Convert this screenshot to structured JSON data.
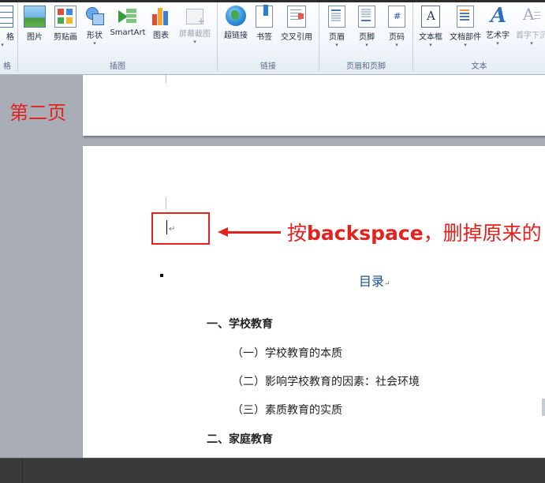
{
  "ribbon": {
    "groups": [
      {
        "label": "格",
        "buttons": [
          {
            "label": "格",
            "icon": "table-icon"
          }
        ]
      },
      {
        "label": "插图",
        "buttons": [
          {
            "label": "图片",
            "icon": "picture-icon"
          },
          {
            "label": "剪贴画",
            "icon": "clipart-icon"
          },
          {
            "label": "形状",
            "icon": "shapes-icon"
          },
          {
            "label": "SmartArt",
            "icon": "smartart-icon"
          },
          {
            "label": "图表",
            "icon": "chart-icon"
          },
          {
            "label": "屏幕截图",
            "icon": "screenshot-icon"
          }
        ]
      },
      {
        "label": "链接",
        "buttons": [
          {
            "label": "超链接",
            "icon": "hyperlink-icon"
          },
          {
            "label": "书签",
            "icon": "bookmark-icon"
          },
          {
            "label": "交叉引用",
            "icon": "cross-reference-icon"
          }
        ]
      },
      {
        "label": "页眉和页脚",
        "buttons": [
          {
            "label": "页眉",
            "icon": "header-icon"
          },
          {
            "label": "页脚",
            "icon": "footer-icon"
          },
          {
            "label": "页码",
            "icon": "page-number-icon"
          }
        ]
      },
      {
        "label": "文本",
        "buttons": [
          {
            "label": "文本框",
            "icon": "textbox-icon"
          },
          {
            "label": "文档部件",
            "icon": "quick-parts-icon"
          },
          {
            "label": "艺术字",
            "icon": "wordart-icon"
          },
          {
            "label": "首字下沉",
            "icon": "drop-cap-icon"
          }
        ]
      }
    ]
  },
  "annotation": {
    "page_label": "第二页",
    "instruction_prefix": "按",
    "instruction_key": "backspace",
    "instruction_suffix": "，删掉原来的"
  },
  "document": {
    "cursor_mark": "↵",
    "toc_title": "目录",
    "paragraph_mark": "↵",
    "toc_entries": [
      {
        "text": "一、学校教育",
        "level": 1
      },
      {
        "text": "（一）学校教育的本质",
        "level": 2
      },
      {
        "text": "（二）影响学校教育的因素：社会环境",
        "level": 2
      },
      {
        "text": "（三）素质教育的实质",
        "level": 2
      },
      {
        "text": "二、家庭教育",
        "level": 1
      }
    ]
  },
  "colors": {
    "annotation_red": "#e5211e",
    "toc_title_blue": "#1f4e8c"
  }
}
